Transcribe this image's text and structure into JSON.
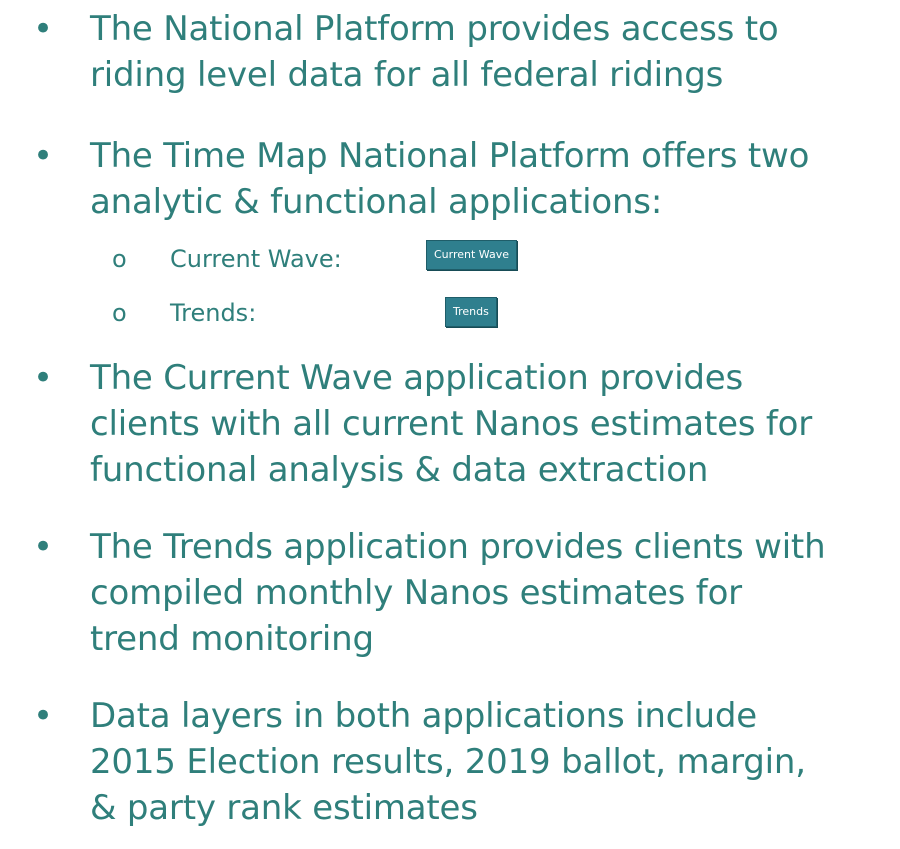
{
  "bullets": [
    {
      "lines": [
        "The National Platform provides access to",
        "riding level data for all federal ridings"
      ]
    },
    {
      "lines": [
        "The Time Map National Platform offers two",
        "analytic & functional applications:"
      ]
    },
    {
      "lines": [
        "The Current Wave application provides",
        "clients with all current Nanos estimates for",
        "functional analysis & data extraction"
      ]
    },
    {
      "lines": [
        "The Trends application provides clients with",
        "compiled monthly Nanos estimates for",
        "trend monitoring"
      ]
    },
    {
      "lines": [
        "Data layers in both applications include",
        "2015 Election results, 2019 ballot, margin,",
        "& party rank estimates"
      ]
    }
  ],
  "subitems": [
    {
      "label": "Current Wave:",
      "button": "Current Wave"
    },
    {
      "label": "Trends:",
      "button": "Trends"
    }
  ],
  "bullet_symbol": "•",
  "sub_symbol": "o",
  "colors": {
    "text": "#2f7f7b",
    "button_bg": "#2f7f8e"
  }
}
